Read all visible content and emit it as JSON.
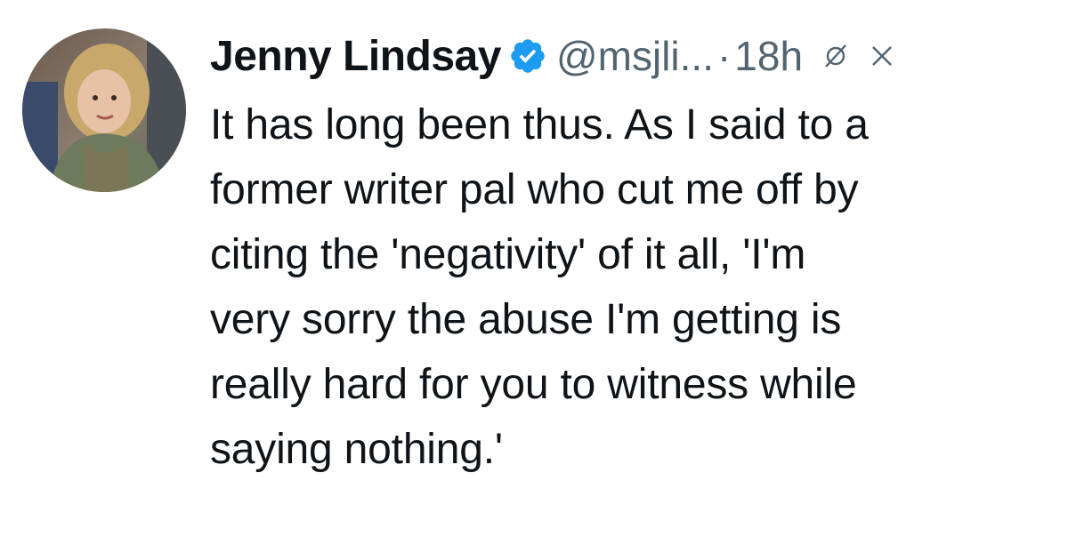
{
  "tweet": {
    "author": {
      "name": "Jenny Lindsay",
      "handle": "@msjli...",
      "verified_icon": "verified-badge-icon",
      "avatar_icon": "avatar-photo"
    },
    "separator": "·",
    "time": "18h",
    "actions": {
      "grok_icon": "grok-icon",
      "close_icon": "close-icon"
    },
    "text": "It has long been thus. As I said to a\nformer writer pal who cut me off by\nciting the 'negativity' of it all, 'I'm\nvery sorry the abuse I'm getting is\nreally hard for you to witness while\nsaying nothing.'"
  },
  "colors": {
    "text": "#0f1419",
    "secondary": "#536471",
    "verified": "#1d9bf0",
    "background": "#ffffff"
  }
}
